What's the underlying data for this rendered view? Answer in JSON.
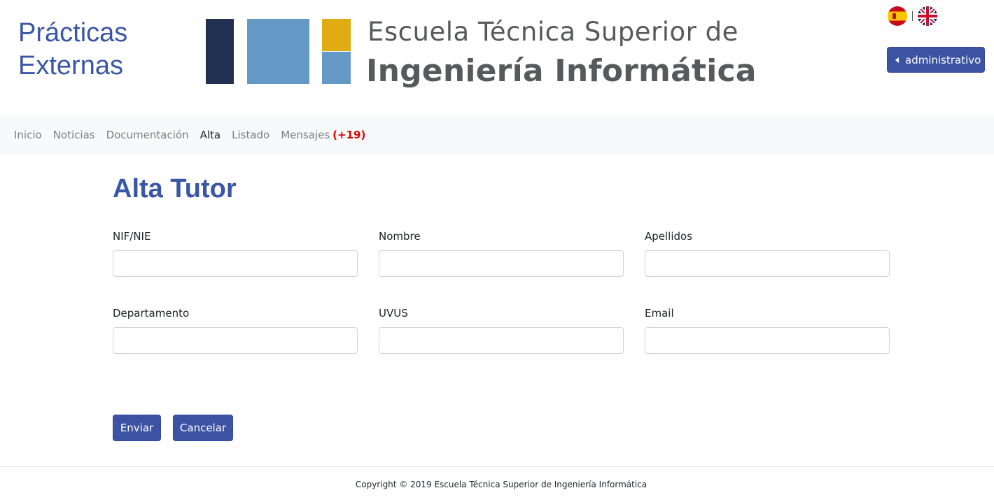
{
  "header": {
    "app_title_line1": "Prácticas",
    "app_title_line2": "Externas",
    "logo_line1": "Escuela Técnica Superior de",
    "logo_line2": "Ingeniería Informática",
    "role_button_label": "administrativo",
    "languages": [
      "spain-flag-icon",
      "uk-flag-icon"
    ]
  },
  "nav": {
    "items": [
      {
        "label": "Inicio"
      },
      {
        "label": "Noticias"
      },
      {
        "label": "Documentación"
      },
      {
        "label": "Alta",
        "active": true
      },
      {
        "label": "Listado"
      },
      {
        "label": "Mensajes",
        "badge": "(+19)"
      }
    ]
  },
  "main": {
    "title": "Alta Tutor",
    "fields": [
      {
        "label": "NIF/NIE",
        "value": ""
      },
      {
        "label": "Nombre",
        "value": ""
      },
      {
        "label": "Apellidos",
        "value": ""
      },
      {
        "label": "Departamento",
        "value": ""
      },
      {
        "label": "UVUS",
        "value": ""
      },
      {
        "label": "Email",
        "value": ""
      }
    ],
    "submit_label": "Enviar",
    "cancel_label": "Cancelar"
  },
  "footer": {
    "copyright": "Copyright © 2019 Escuela Técnica Superior de Ingeniería Informática"
  },
  "colors": {
    "brand_blue": "#3a56a6",
    "button_blue": "#3c53a4",
    "logo_navy": "#223052",
    "logo_light_blue": "#6499c5",
    "logo_yellow": "#e0ac12",
    "badge_red": "#e00000"
  }
}
